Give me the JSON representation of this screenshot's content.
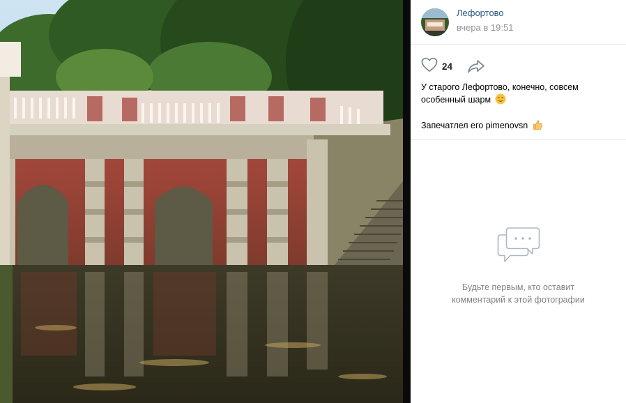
{
  "post": {
    "author": "Лефортово",
    "time": "вчера в 19:51",
    "likes": "24",
    "caption_line1": "У старого Лефортово, конечно, совсем особенный шарм",
    "caption_emoji1": "smiling-relieved-emoji",
    "caption_line2": "Запечатлел его pimenovsn",
    "caption_emoji2": "thumbs-up-emoji"
  },
  "comments": {
    "empty_text": "Будьте первым, кто оставит комментарий к этой фотографии"
  },
  "colors": {
    "link": "#2a5885",
    "muted": "#939393",
    "icon": "#818c99",
    "divider": "#e7e8ec"
  },
  "icons": {
    "like": "heart-icon",
    "share": "share-arrow-icon",
    "comments": "speech-bubble-icon"
  }
}
